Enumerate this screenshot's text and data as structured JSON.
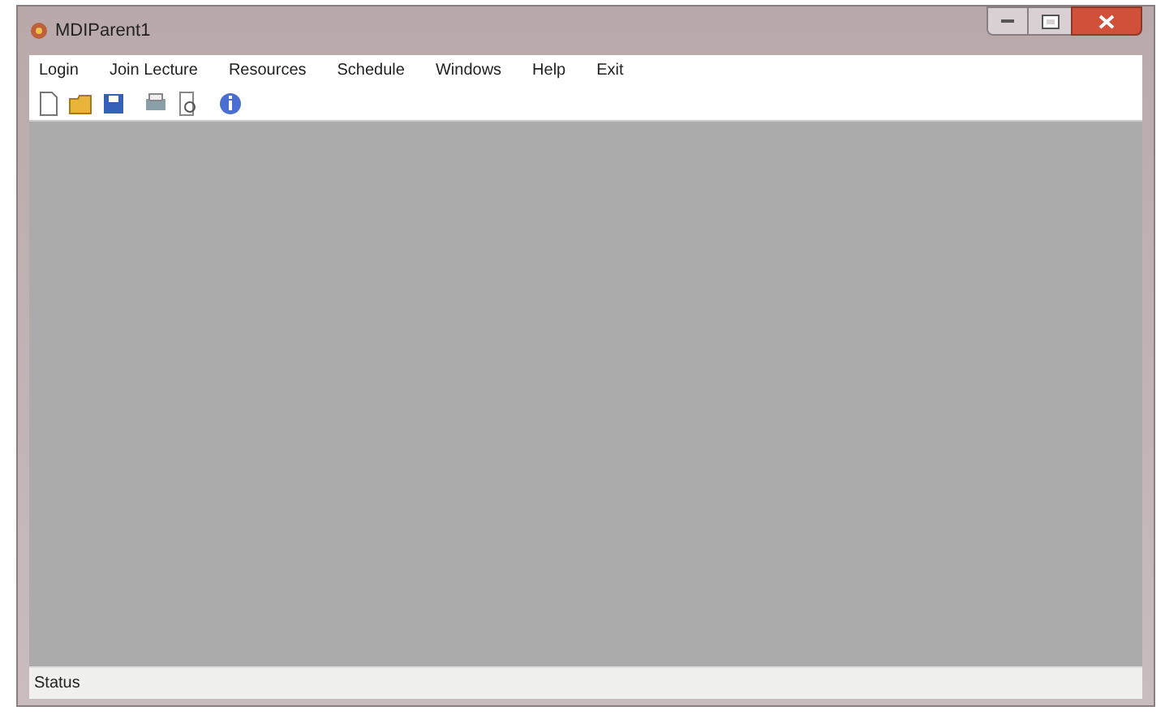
{
  "window": {
    "title": "MDIParent1"
  },
  "menu": [
    {
      "label": "Login"
    },
    {
      "label": "Join Lecture"
    },
    {
      "label": "Resources"
    },
    {
      "label": "Schedule"
    },
    {
      "label": "Windows"
    },
    {
      "label": "Help"
    },
    {
      "label": "Exit"
    }
  ],
  "status_bar": {
    "text": "Status"
  }
}
